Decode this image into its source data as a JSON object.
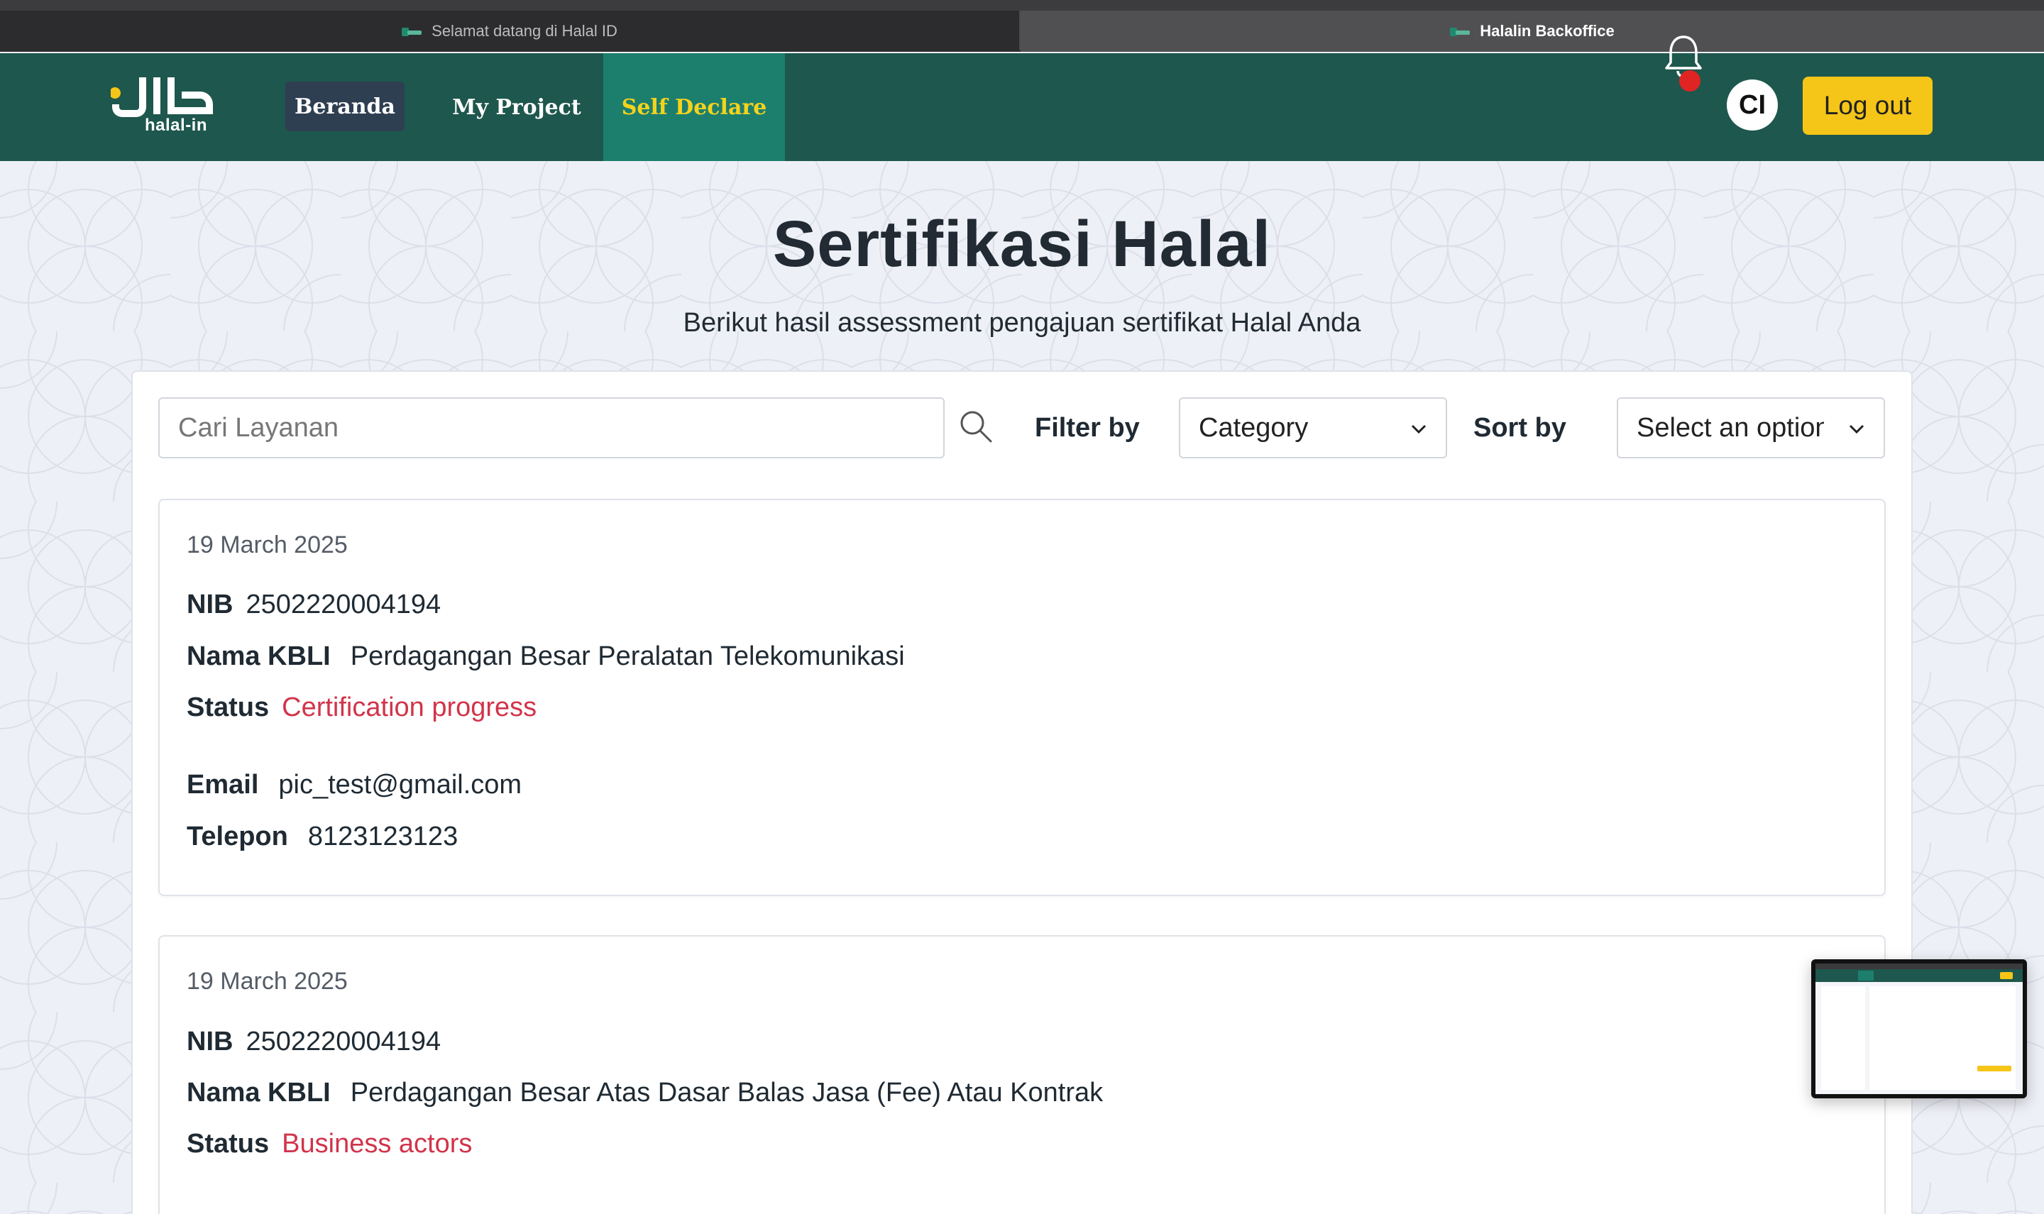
{
  "browser": {
    "tabs": [
      {
        "label": "Selamat datang di Halal ID",
        "active": false
      },
      {
        "label": "Halalin Backoffice",
        "active": true
      }
    ]
  },
  "navbar": {
    "logo_text": "halal-in",
    "items": [
      {
        "label": "Beranda"
      },
      {
        "label": "My Project"
      },
      {
        "label": "Self Declare"
      }
    ],
    "avatar_initials": "CI",
    "logout_label": "Log out",
    "colors": {
      "background": "#1e574d",
      "active_tab": "#1c7f6e",
      "active_text": "#f5d31b",
      "logout_bg": "#f5c518",
      "notification_dot": "#e02424"
    }
  },
  "page": {
    "title": "Sertifikasi Halal",
    "subtitle": "Berikut hasil assessment pengajuan sertifikat Halal Anda"
  },
  "filters": {
    "search_placeholder": "Cari Layanan",
    "filter_label": "Filter by",
    "category_value": "Category",
    "sort_label": "Sort by",
    "sort_value": "Select an option"
  },
  "labels": {
    "nib": "NIB",
    "kbli": "Nama KBLI",
    "status": "Status",
    "email": "Email",
    "telepon": "Telepon"
  },
  "cards": [
    {
      "date": "19 March 2025",
      "nib": "2502220004194",
      "kbli": "Perdagangan Besar Peralatan Telekomunikasi",
      "status": "Certification progress",
      "email": "pic_test@gmail.com",
      "telepon": "8123123123"
    },
    {
      "date": "19 March 2025",
      "nib": "2502220004194",
      "kbli": "Perdagangan Besar Atas Dasar Balas Jasa (Fee) Atau Kontrak",
      "status": "Business actors"
    }
  ]
}
